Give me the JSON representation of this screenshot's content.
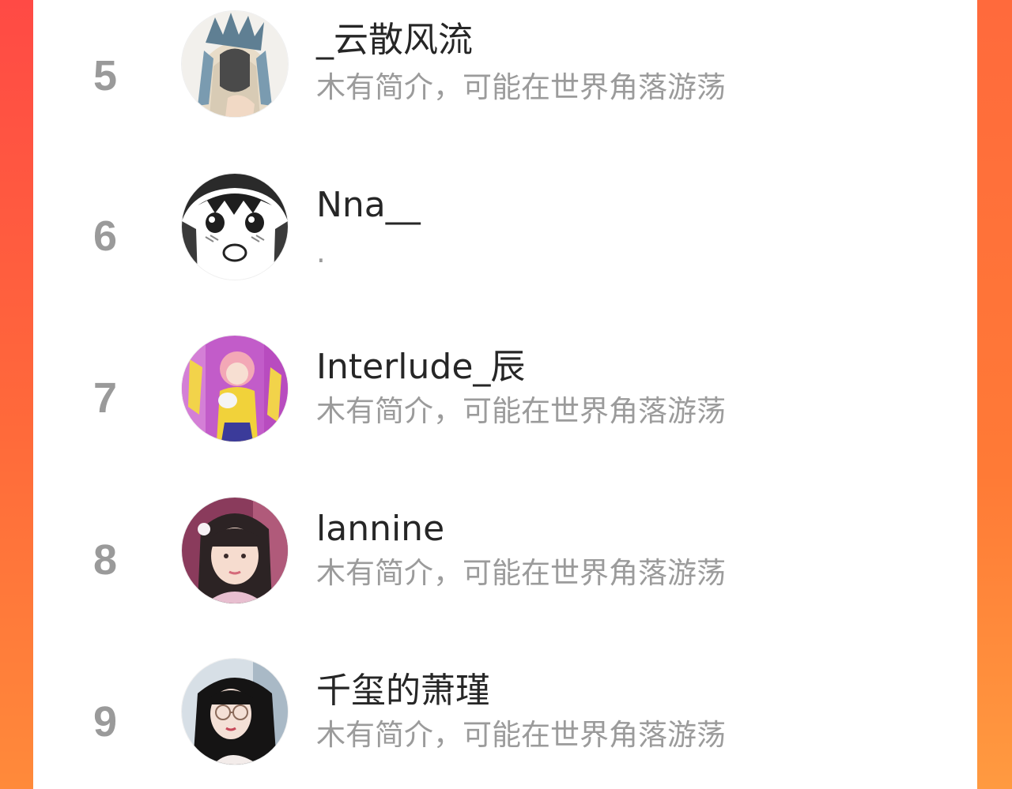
{
  "ranking_list": {
    "items": [
      {
        "rank": "5",
        "name": "_云散风流",
        "bio": "木有简介，可能在世界角落游荡",
        "avatar": "anime-crowned-girl-avatar"
      },
      {
        "rank": "6",
        "name": "Nna__",
        "bio": ".",
        "avatar": "manga-blushing-girl-avatar"
      },
      {
        "rank": "7",
        "name": "Interlude_辰",
        "bio": "木有简介，可能在世界角落游荡",
        "avatar": "pink-hair-anime-girl-avatar"
      },
      {
        "rank": "8",
        "name": "lannine",
        "bio": "木有简介，可能在世界角落游荡",
        "avatar": "girl-photo-avatar"
      },
      {
        "rank": "9",
        "name": "千玺的萧瑾",
        "bio": "木有简介，可能在世界角落游荡",
        "avatar": "girl-with-glasses-photo-avatar"
      }
    ]
  },
  "colors": {
    "background_gradient_start": "#ff4a45",
    "background_gradient_end": "#ff8a3a",
    "panel": "#ffffff",
    "rank_text": "#9a9a9a",
    "name_text": "#262626",
    "bio_text": "#9b9b9b"
  }
}
